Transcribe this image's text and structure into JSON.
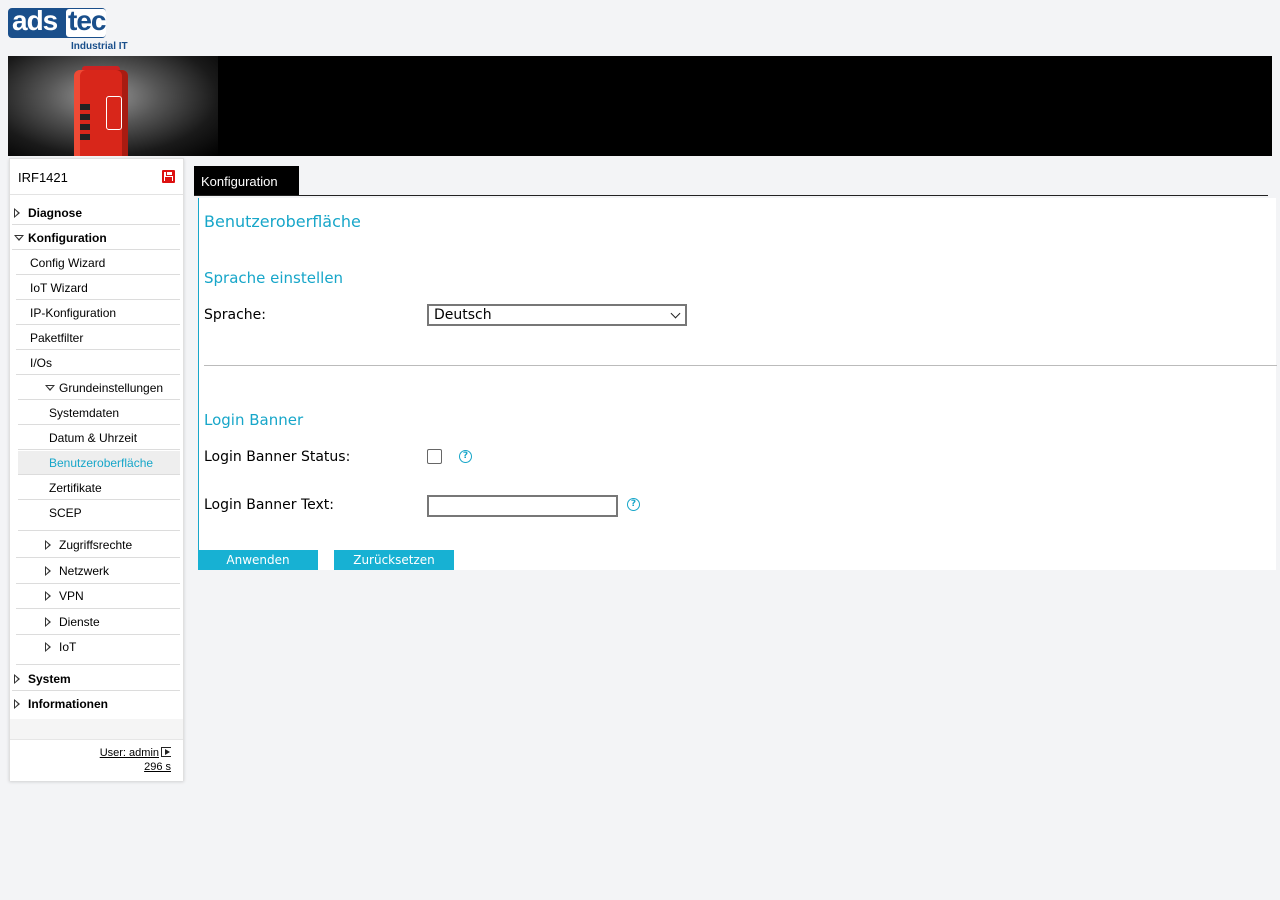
{
  "logo": {
    "brand_a": "ads",
    "brand_b": "tec",
    "tagline": "Industrial IT"
  },
  "sidebar": {
    "device_name": "IRF1421",
    "items": [
      {
        "label": "Diagnose"
      },
      {
        "label": "Konfiguration"
      },
      {
        "label": "Config Wizard"
      },
      {
        "label": "IoT Wizard"
      },
      {
        "label": "IP-Konfiguration"
      },
      {
        "label": "Paketfilter"
      },
      {
        "label": "I/Os"
      },
      {
        "label": "Grundeinstellungen"
      },
      {
        "label": "Systemdaten"
      },
      {
        "label": "Datum & Uhrzeit"
      },
      {
        "label": "Benutzeroberfläche"
      },
      {
        "label": "Zertifikate"
      },
      {
        "label": "SCEP"
      },
      {
        "label": "Zugriffsrechte"
      },
      {
        "label": "Netzwerk"
      },
      {
        "label": "VPN"
      },
      {
        "label": "Dienste"
      },
      {
        "label": "IoT"
      },
      {
        "label": "System"
      },
      {
        "label": "Informationen"
      }
    ],
    "user": "User: admin",
    "timer": "296 s"
  },
  "tab": {
    "label": "Konfiguration"
  },
  "main": {
    "title": "Benutzeroberfläche",
    "section_language": "Sprache einstellen",
    "language_label": "Sprache:",
    "language_value": "Deutsch",
    "section_banner": "Login Banner",
    "banner_status_label": "Login Banner Status:",
    "banner_text_label": "Login Banner Text:",
    "banner_text_value": "",
    "help_glyph": "?",
    "apply_label": "Anwenden",
    "reset_label": "Zurücksetzen"
  },
  "colors": {
    "accent": "#17a6c9",
    "logo": "#1a4f8b",
    "device_red": "#d8261a"
  }
}
